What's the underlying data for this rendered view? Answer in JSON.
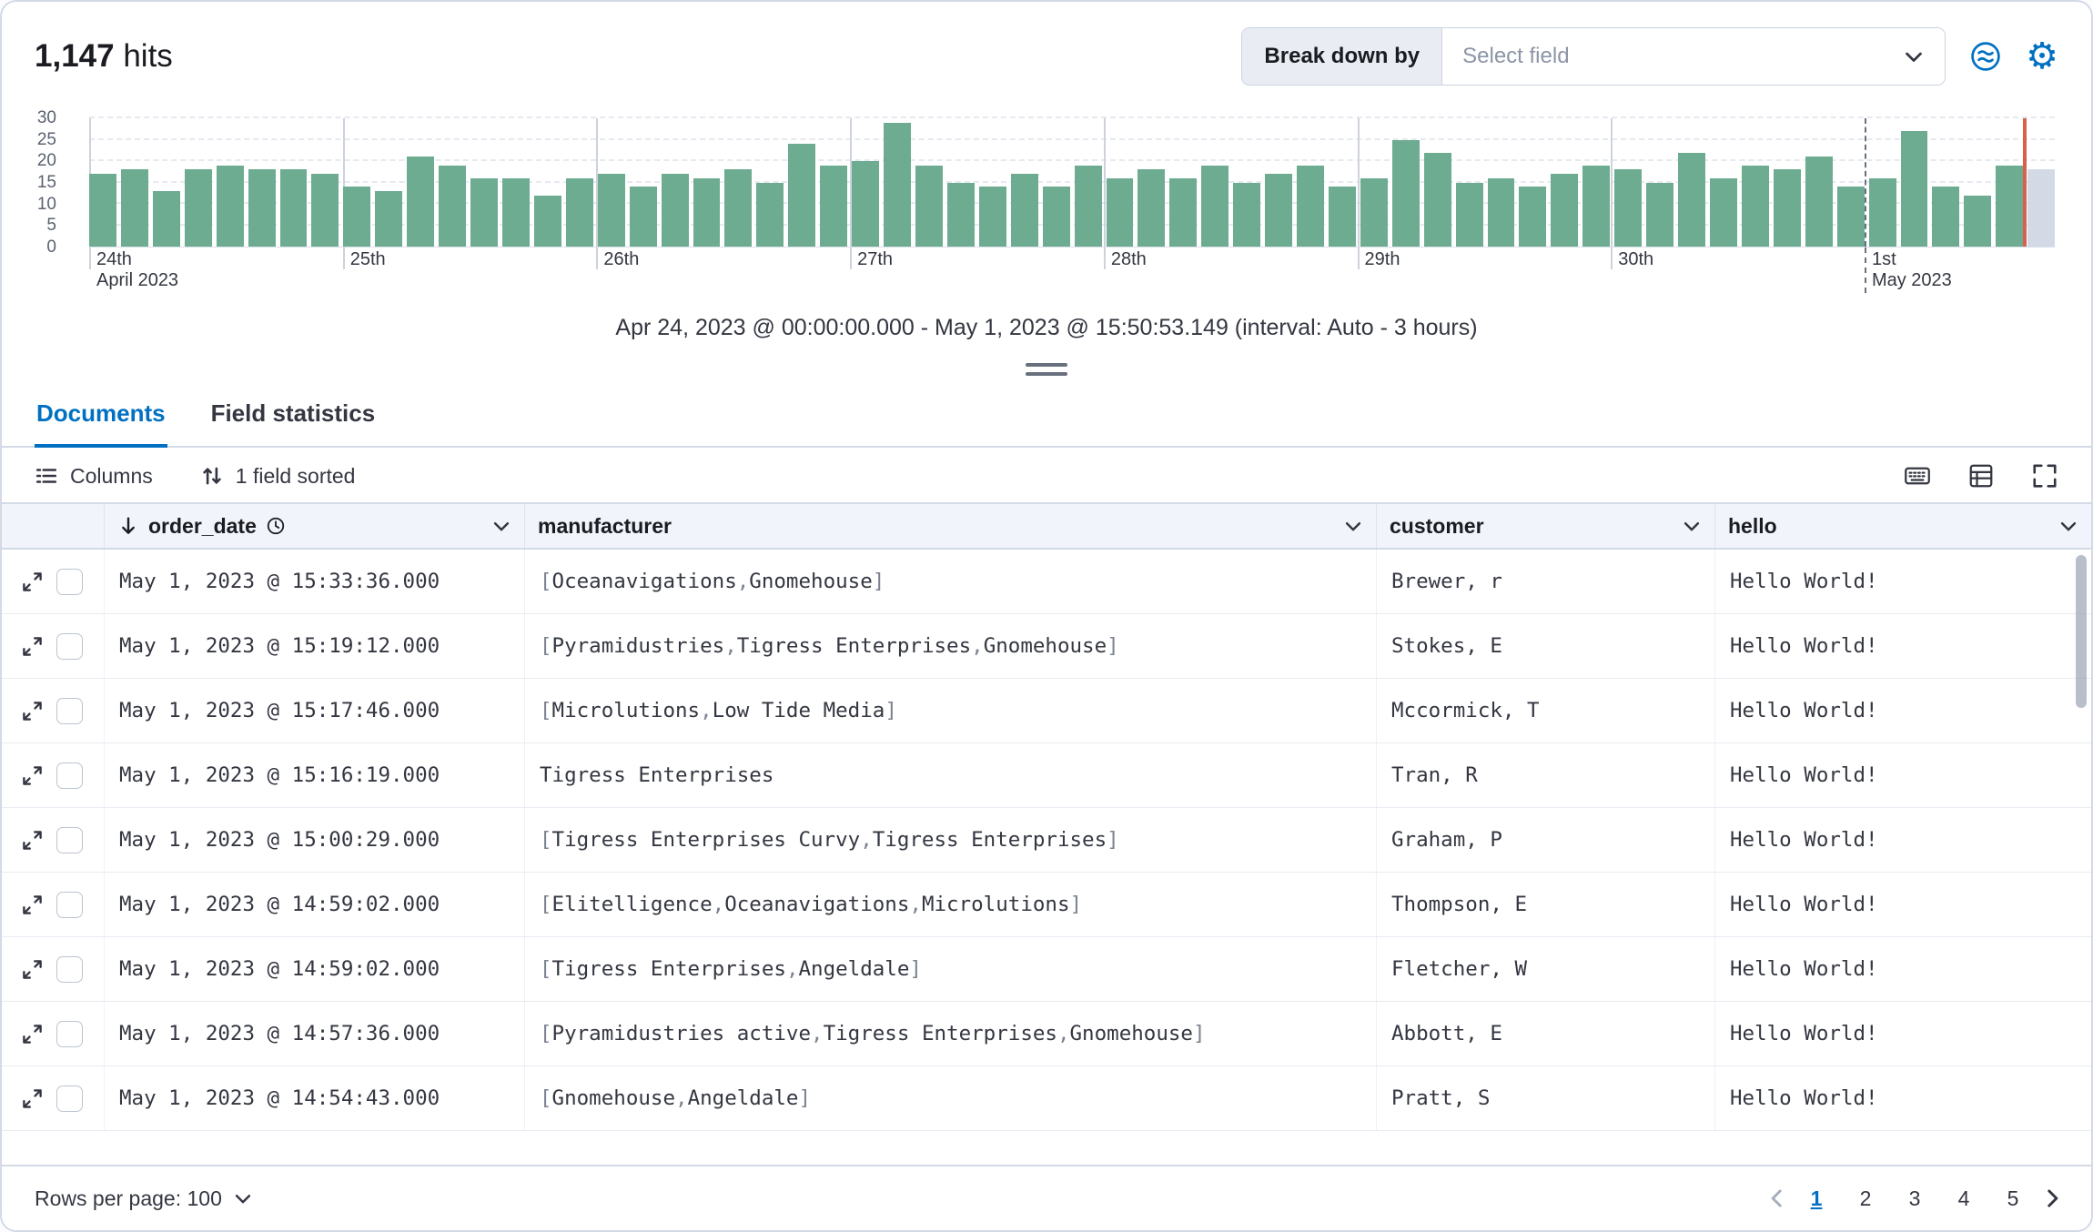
{
  "header": {
    "hits_count": "1,147",
    "hits_label": "hits",
    "breakdown_label": "Break down by",
    "breakdown_placeholder": "Select field"
  },
  "chart_data": {
    "type": "bar",
    "title": "Document count histogram",
    "caption": "Apr 24, 2023 @ 00:00:00.000 - May 1, 2023 @ 15:50:53.149 (interval: Auto - 3 hours)",
    "interval": "3 hours",
    "ylim": [
      0,
      30
    ],
    "yticks": [
      0,
      5,
      10,
      15,
      20,
      25,
      30
    ],
    "bar_color": "#6dac91",
    "partial_bar_color": "#d3dae6",
    "current_time_color": "#d9604a",
    "partial_last": true,
    "values": [
      17,
      18,
      13,
      18,
      19,
      18,
      18,
      17,
      14,
      13,
      21,
      19,
      16,
      16,
      12,
      16,
      17,
      14,
      17,
      16,
      18,
      15,
      24,
      19,
      20,
      29,
      19,
      15,
      14,
      17,
      14,
      19,
      16,
      18,
      16,
      19,
      15,
      17,
      19,
      14,
      16,
      25,
      22,
      15,
      16,
      14,
      17,
      19,
      18,
      15,
      22,
      16,
      19,
      18,
      21,
      14,
      16,
      27,
      14,
      12,
      19,
      18
    ],
    "day_ticks": [
      {
        "index": 0,
        "label": "24th",
        "sublabel": "April 2023",
        "style": "solid"
      },
      {
        "index": 8,
        "label": "25th",
        "sublabel": "",
        "style": "solid"
      },
      {
        "index": 16,
        "label": "26th",
        "sublabel": "",
        "style": "solid"
      },
      {
        "index": 24,
        "label": "27th",
        "sublabel": "",
        "style": "solid"
      },
      {
        "index": 32,
        "label": "28th",
        "sublabel": "",
        "style": "solid"
      },
      {
        "index": 40,
        "label": "29th",
        "sublabel": "",
        "style": "solid"
      },
      {
        "index": 48,
        "label": "30th",
        "sublabel": "",
        "style": "solid"
      },
      {
        "index": 56,
        "label": "1st",
        "sublabel": "May 2023",
        "style": "dashed"
      }
    ]
  },
  "tabs": [
    {
      "label": "Documents",
      "active": true
    },
    {
      "label": "Field statistics",
      "active": false
    }
  ],
  "toolbar": {
    "columns_label": "Columns",
    "sorted_label": "1 field sorted"
  },
  "table": {
    "columns": [
      {
        "label": "order_date",
        "sorted": "desc",
        "time_field": true
      },
      {
        "label": "manufacturer"
      },
      {
        "label": "customer"
      },
      {
        "label": "hello"
      }
    ],
    "rows": [
      {
        "order_date": "May 1, 2023 @ 15:33:36.000",
        "manufacturer": [
          "Oceanavigations",
          "Gnomehouse"
        ],
        "customer": "Brewer, r",
        "hello": "Hello World!"
      },
      {
        "order_date": "May 1, 2023 @ 15:19:12.000",
        "manufacturer": [
          "Pyramidustries",
          "Tigress Enterprises",
          "Gnomehouse"
        ],
        "customer": "Stokes, E",
        "hello": "Hello World!"
      },
      {
        "order_date": "May 1, 2023 @ 15:17:46.000",
        "manufacturer": [
          "Microlutions",
          "Low Tide Media"
        ],
        "customer": "Mccormick, T",
        "hello": "Hello World!"
      },
      {
        "order_date": "May 1, 2023 @ 15:16:19.000",
        "manufacturer": "Tigress Enterprises",
        "customer": "Tran, R",
        "hello": "Hello World!"
      },
      {
        "order_date": "May 1, 2023 @ 15:00:29.000",
        "manufacturer": [
          "Tigress Enterprises Curvy",
          "Tigress Enterprises"
        ],
        "customer": "Graham, P",
        "hello": "Hello World!"
      },
      {
        "order_date": "May 1, 2023 @ 14:59:02.000",
        "manufacturer": [
          "Elitelligence",
          "Oceanavigations",
          "Microlutions"
        ],
        "customer": "Thompson, E",
        "hello": "Hello World!"
      },
      {
        "order_date": "May 1, 2023 @ 14:59:02.000",
        "manufacturer": [
          "Tigress Enterprises",
          "Angeldale"
        ],
        "customer": "Fletcher, W",
        "hello": "Hello World!"
      },
      {
        "order_date": "May 1, 2023 @ 14:57:36.000",
        "manufacturer": [
          "Pyramidustries active",
          "Tigress Enterprises",
          "Gnomehouse"
        ],
        "customer": "Abbott, E",
        "hello": "Hello World!"
      },
      {
        "order_date": "May 1, 2023 @ 14:54:43.000",
        "manufacturer": [
          "Gnomehouse",
          "Angeldale"
        ],
        "customer": "Pratt, S",
        "hello": "Hello World!"
      }
    ]
  },
  "footer": {
    "rows_per_page_label": "Rows per page: 100",
    "pages": [
      "1",
      "2",
      "3",
      "4",
      "5"
    ],
    "current_page": "1"
  }
}
